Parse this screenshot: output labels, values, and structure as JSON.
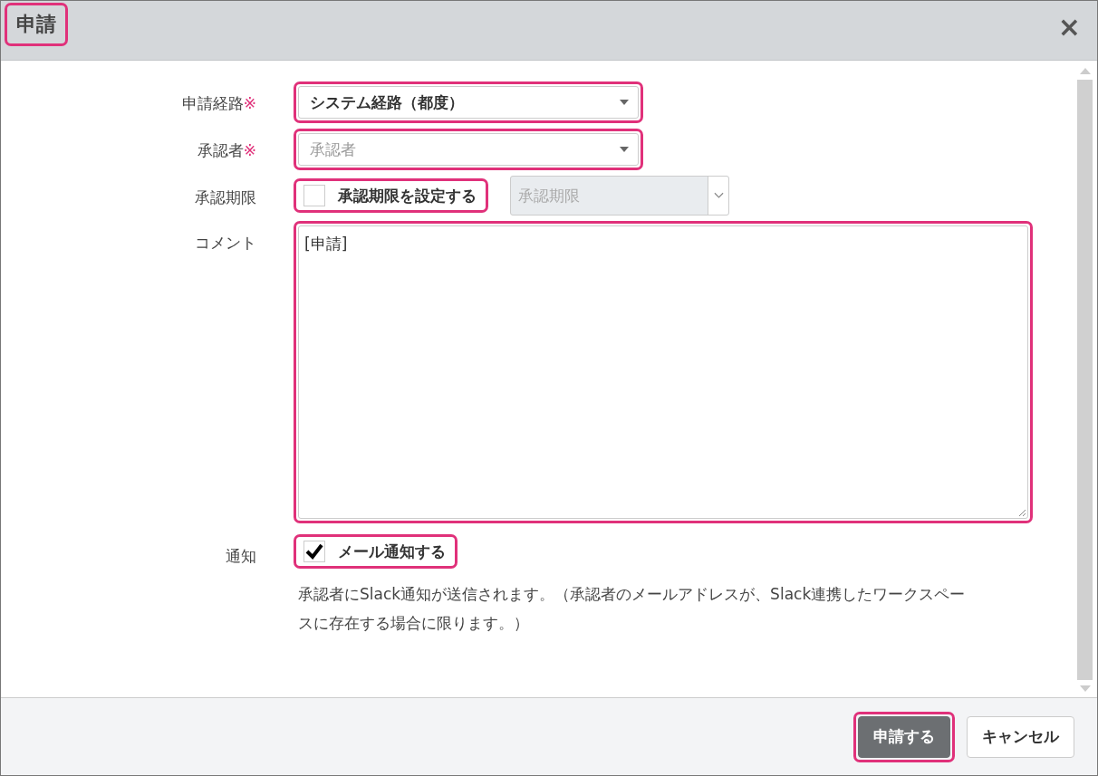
{
  "dialog": {
    "title": "申請",
    "title_highlighted": true,
    "close": "×"
  },
  "fields": [
    {
      "kind": "select",
      "label": "申請経路",
      "required": true,
      "value": "システム経路（都度）",
      "highlighted": true
    },
    {
      "kind": "select",
      "label": "承認者",
      "required": true,
      "placeholder": "承認者",
      "highlighted": true
    },
    {
      "kind": "checkdate",
      "label": "承認期限",
      "required": false,
      "checkbox": {
        "label": "承認期限を設定する",
        "checked": false,
        "highlighted": true
      },
      "date": {
        "placeholder": "承認期限",
        "disabled": true
      }
    },
    {
      "kind": "textarea",
      "label": "コメント",
      "required": false,
      "value": "[申請]",
      "highlighted": true
    },
    {
      "kind": "check",
      "label": "通知",
      "required": false,
      "checkbox": {
        "label": "メール通知する",
        "checked": true,
        "highlighted": true
      },
      "help": "承認者にSlack通知が送信されます。（承認者のメールアドレスが、Slack連携したワークスペースに存在する場合に限ります。）"
    }
  ],
  "mark": "※",
  "buttons": [
    {
      "label": "申請する",
      "kind": "primary",
      "highlighted": true
    },
    {
      "label": "キャンセル",
      "kind": "secondary",
      "highlighted": false
    }
  ]
}
